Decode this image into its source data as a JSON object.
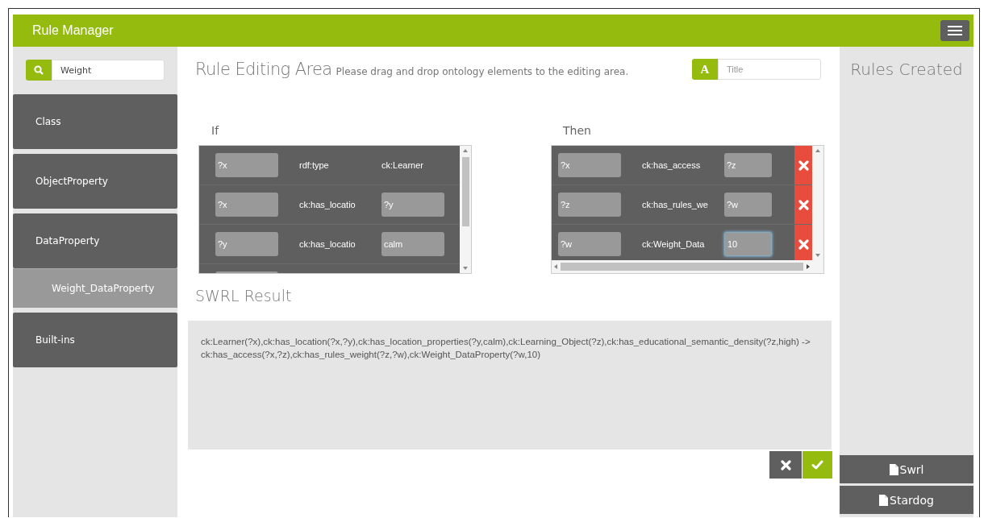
{
  "header": {
    "title": "Rule Manager"
  },
  "search": {
    "value": "Weight"
  },
  "sidebar": {
    "items": [
      {
        "label": "Class",
        "selected": false
      },
      {
        "label": "ObjectProperty",
        "selected": false
      },
      {
        "label": "DataProperty",
        "selected": false,
        "children": [
          {
            "label": "Weight_DataProperty",
            "selected": true
          }
        ]
      },
      {
        "label": "Built-ins",
        "selected": false
      }
    ]
  },
  "editor": {
    "title": "Rule Editing Area",
    "hint": "Please drag and drop ontology elements to the editing area.",
    "title_field": {
      "icon_letter": "A",
      "placeholder": "Title"
    },
    "if": {
      "label": "If",
      "rows": [
        {
          "subject": "?x",
          "predicate": "rdf:type",
          "object": "ck:Learner",
          "kind": "text"
        },
        {
          "subject": "?x",
          "predicate": "ck:has_locatio",
          "object": "?y",
          "kind": "field"
        },
        {
          "subject": "?y",
          "predicate": "ck:has_locatio",
          "object": "calm",
          "kind": "field"
        }
      ]
    },
    "then": {
      "label": "Then",
      "rows": [
        {
          "subject": "?x",
          "predicate": "ck:has_access",
          "object": "?z",
          "focused": false
        },
        {
          "subject": "?z",
          "predicate": "ck:has_rules_we",
          "object": "?w",
          "focused": false
        },
        {
          "subject": "?w",
          "predicate": "ck:Weight_Data",
          "object": "10",
          "focused": true
        }
      ]
    }
  },
  "result": {
    "title": "SWRL Result",
    "text": "ck:Learner(?x),ck:has_location(?x,?y),ck:has_location_properties(?y,calm),ck:Learning_Object(?z),ck:has_educational_semantic_density(?z,high) -> ck:has_access(?x,?z),ck:has_rules_weight(?z,?w),ck:Weight_DataProperty(?w,10)"
  },
  "rules_panel": {
    "title": "Rules Created",
    "buttons": [
      "Swrl",
      "Stardog"
    ]
  }
}
